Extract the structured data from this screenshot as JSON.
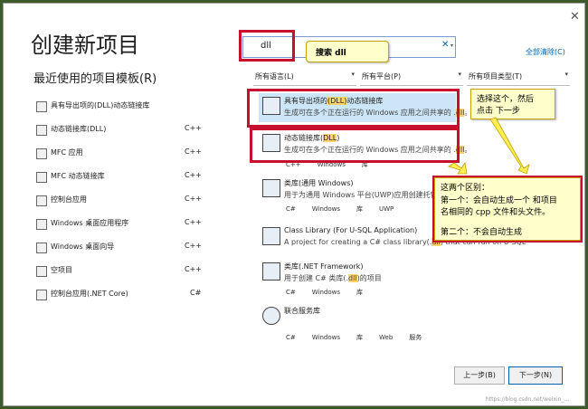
{
  "window": {
    "title": "创建新项目",
    "close_glyph": "✕"
  },
  "recent": {
    "title": "最近使用的项目模板(R)",
    "items": [
      {
        "label": "具有导出项的(DLL)动态链接库",
        "lang": ""
      },
      {
        "label": "动态链接库(DLL)",
        "lang": "C++"
      },
      {
        "label": "MFC 应用",
        "lang": "C++"
      },
      {
        "label": "MFC 动态链接库",
        "lang": "C++"
      },
      {
        "label": "控制台应用",
        "lang": "C++"
      },
      {
        "label": "Windows 桌面应用程序",
        "lang": "C++"
      },
      {
        "label": "Windows 桌面向导",
        "lang": "C++"
      },
      {
        "label": "空项目",
        "lang": "C++"
      },
      {
        "label": "控制台应用(.NET Core)",
        "lang": "C#"
      }
    ]
  },
  "search": {
    "value": "dll",
    "clear_glyph": "✕",
    "drop_glyph": "▾"
  },
  "clear_all": "全部清除(C)",
  "filters": [
    {
      "label": "所有语言(L)",
      "drop": "▾"
    },
    {
      "label": "所有平台(P)",
      "drop": "▾"
    },
    {
      "label": "所有项目类型(T)",
      "drop": "▾"
    }
  ],
  "templates": [
    {
      "name_pre": "具有导出项的",
      "name_hl": "(DLL)",
      "name_post": "动态链接库",
      "desc_pre": "生成可在多个正在运行的 Windows 应用之间共享的 .",
      "desc_hl": "dll",
      "desc_post": "。",
      "tags": []
    },
    {
      "name_pre": "动态链接库(",
      "name_hl": "DLL",
      "name_post": ")",
      "desc_pre": "生成可在多个正在运行的 Windows 应用之间共享的 .",
      "desc_hl": "dll",
      "desc_post": "。",
      "tags": [
        "C++",
        "Windows",
        "库"
      ]
    },
    {
      "name_pre": "类库(通用 Windows)",
      "name_hl": "",
      "name_post": "",
      "desc_pre": "用于为通用 Windows 平台(UWP)应用创建托管类库",
      "desc_hl": "",
      "desc_post": "",
      "tags": [
        "C#",
        "Windows",
        "库",
        "UWP"
      ]
    },
    {
      "name_pre": "Class Library (For U-SQL Application)",
      "name_hl": "",
      "name_post": "",
      "desc_pre": "A project for creating a C# class library(.",
      "desc_hl": "dll",
      "desc_post": ") that can run on U-SQL",
      "tags": []
    },
    {
      "name_pre": "类库(.NET Framework)",
      "name_hl": "",
      "name_post": "",
      "desc_pre": "用于创建 C# 类库(.",
      "desc_hl": "dll",
      "desc_post": ")的项目",
      "tags": [
        "C#",
        "Windows",
        "库"
      ]
    },
    {
      "name_pre": "联合服务库",
      "name_hl": "",
      "name_post": "",
      "desc_pre": "",
      "desc_hl": "",
      "desc_post": "",
      "tags": [
        "C#",
        "Windows",
        "库",
        "Web",
        "服务"
      ]
    }
  ],
  "callouts": {
    "search": "搜索 dll",
    "choose": [
      "选择这个，然后",
      "点击 下一步"
    ],
    "difference": [
      "这两个区别：",
      "第一个：会自动生成一个 和项目",
      "名相同的 cpp 文件和头文件。",
      "",
      "第二个：不会自动生成"
    ]
  },
  "buttons": {
    "back": "上一步(B)",
    "next": "下一步(N)"
  },
  "watermark": "https://blog.csdn.net/weixin_..."
}
